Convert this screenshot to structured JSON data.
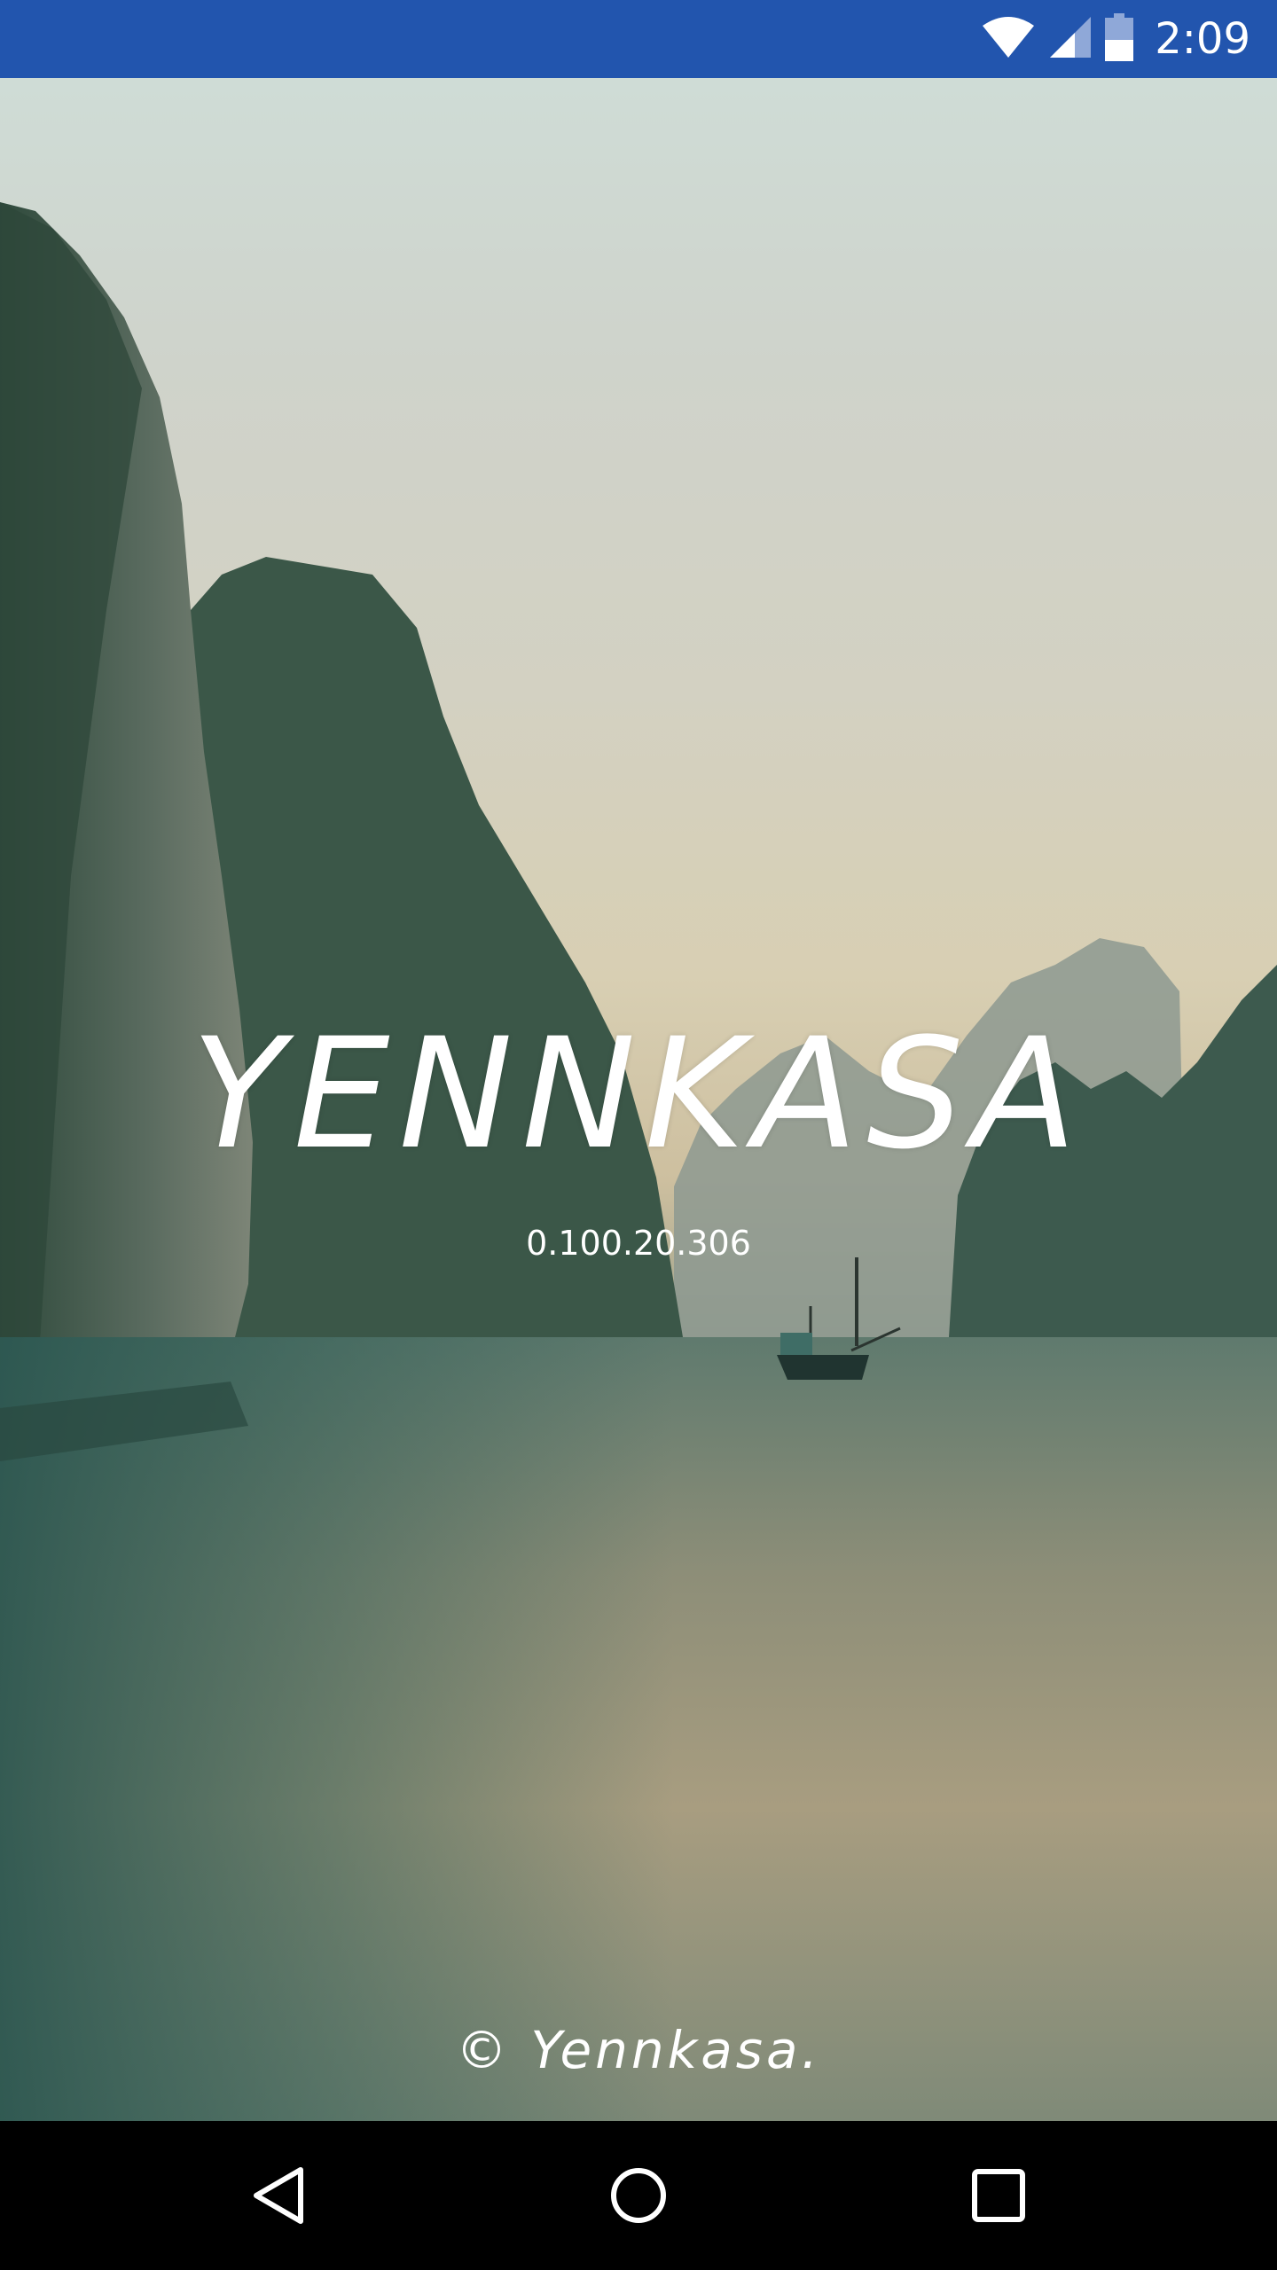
{
  "status_bar": {
    "time": "2:09",
    "background_color": "#2255ae",
    "icons": [
      "wifi-icon",
      "cellular-signal-icon",
      "battery-icon"
    ]
  },
  "splash": {
    "title": "YENNKASA",
    "version": "0.100.20.306",
    "copyright": "© Yennkasa."
  },
  "nav_bar": {
    "buttons": [
      "back-button",
      "home-button",
      "recents-button"
    ]
  }
}
